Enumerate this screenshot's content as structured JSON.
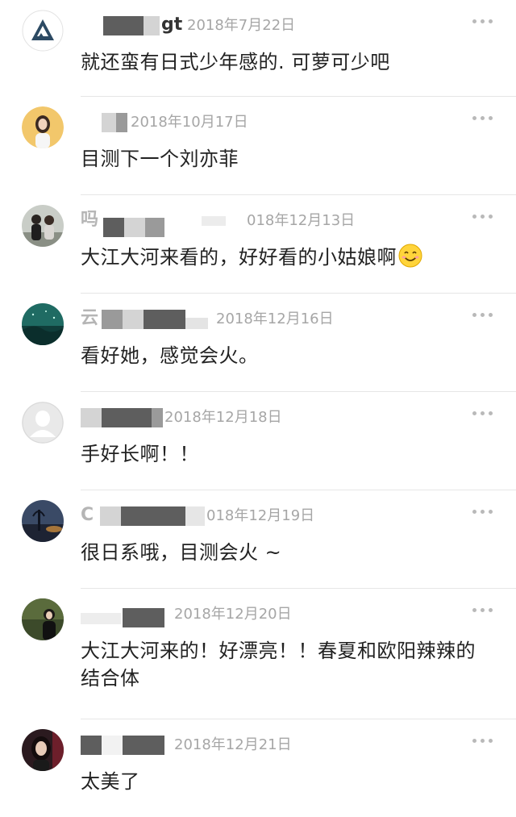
{
  "comments": [
    {
      "user_fragment": "gt",
      "timestamp": "2018年7月22日",
      "text": "就还蛮有日式少年感的. 可萝可少吧",
      "avatar": "mountain-logo-avatar"
    },
    {
      "user_fragment": "",
      "timestamp": "2018年10月17日",
      "text": "目测下一个刘亦菲",
      "avatar": "girl-portrait-avatar"
    },
    {
      "user_fragment": "",
      "timestamp": "018年12月13日",
      "text": "大江大河来看的，好好看的小姑娘啊",
      "emoji": "smiling-face-emoji",
      "avatar": "couple-photo-avatar"
    },
    {
      "user_fragment": "",
      "timestamp": "2018年12月16日",
      "text": "看好她，感觉会火。",
      "avatar": "landscape-avatar"
    },
    {
      "user_fragment": "",
      "timestamp": "2018年12月18日",
      "text": "手好长啊！！",
      "avatar": "default-user-avatar"
    },
    {
      "user_fragment": "C",
      "timestamp": "018年12月19日",
      "text": "很日系哦，目测会火 ~",
      "avatar": "dusk-landscape-avatar"
    },
    {
      "user_fragment": "",
      "timestamp": "2018年12月20日",
      "text": "大江大河来的！好漂亮！！春夏和欧阳辣辣的结合体",
      "avatar": "woman-photo-avatar"
    },
    {
      "user_fragment": "",
      "timestamp": "2018年12月21日",
      "text": "太美了",
      "avatar": "dark-hair-woman-avatar"
    }
  ],
  "more_icon": "more-options-icon",
  "colors": {
    "timestamp": "#a6a6a6",
    "comment_text": "#222222",
    "divider": "#e6e6e6",
    "more_dots": "#b9b9b9"
  }
}
